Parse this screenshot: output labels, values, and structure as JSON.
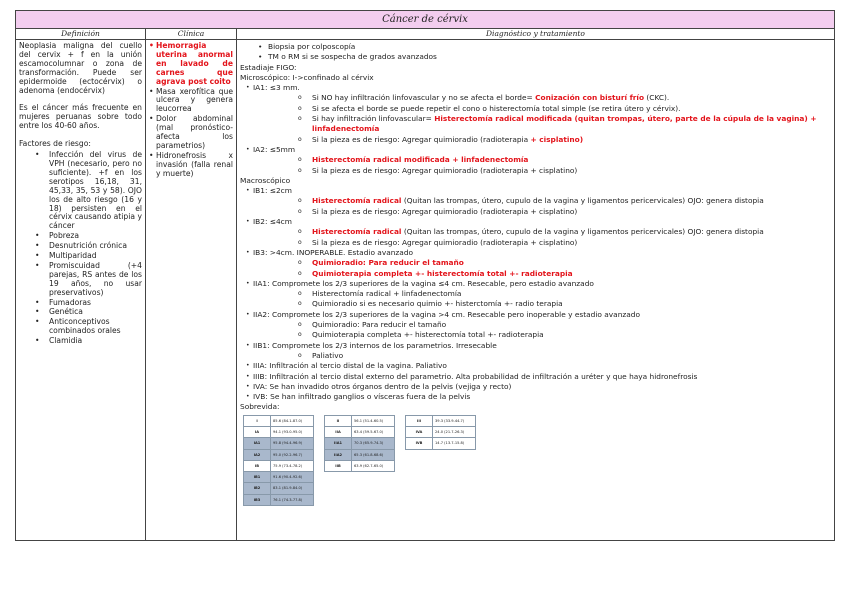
{
  "title": "Cáncer de cérvix",
  "headers": {
    "definicion": "Definición",
    "clinica": "Clínica",
    "diagnostico": "Diagnóstico y tratamiento"
  },
  "definicion": {
    "p1": "Neoplasia maligna del cuello del cervix + f en la unión escamocolumnar o zona de transformación. Puede ser epidermoide (ectocérvix) o adenoma (endocérvix)",
    "p2": "Es el cáncer más frecuente en mujeres peruanas sobre todo entre los 40-60 años.",
    "factores_label": "Factores de riesgo:",
    "factores": [
      "Infección del virus de VPH (necesario, pero no suficiente). +f en los serotipos 16,18, 31, 45,33, 35, 53 y 58). OJO los de alto riesgo (16 y 18) persisten en el cérvix causando atipia y cáncer",
      "Pobreza",
      "Desnutrición crónica",
      "Multiparidad",
      "Promiscuidad (+4 parejas, RS antes de los 19 años, no usar preservativos)",
      "Fumadoras",
      "Genética",
      "Anticonceptivos combinados orales",
      "Clamidia"
    ]
  },
  "clinica": [
    {
      "t": "Hemorragia uterina anormal en lavado de carnes que agrava post coito",
      "red": true
    },
    {
      "t": "Masa xerofítica que ulcera y genera leucorrea",
      "red": false
    },
    {
      "t": "Dolor abdominal (mal pronóstico- afecta los parametrios)",
      "red": false
    },
    {
      "t": "Hidronefrosis x invasión (falla renal y muerte)",
      "red": false
    }
  ],
  "diagnostico": [
    {
      "l": "lb",
      "s": [
        {
          "t": "Biopsia por colposcopía"
        }
      ]
    },
    {
      "l": "lb",
      "s": [
        {
          "t": "TM o RM si se sospecha de grados avanzados"
        }
      ]
    },
    {
      "l": "l0",
      "s": [
        {
          "t": "Estadiaje FIGO:"
        }
      ]
    },
    {
      "l": "l0",
      "s": [
        {
          "t": "Microscópico: I->confinado al cérvix"
        }
      ]
    },
    {
      "l": "l1",
      "s": [
        {
          "t": "IA1: ≤3 mm."
        }
      ]
    },
    {
      "l": "l2",
      "s": [
        {
          "t": "Si NO hay infiltración linfovascular y no se afecta el borde= "
        },
        {
          "t": "Conización con bisturí frío",
          "r": 1
        },
        {
          "t": " (CKC)."
        }
      ]
    },
    {
      "l": "l2",
      "s": [
        {
          "t": "Si se afecta el borde se puede repetir el cono o histerectomía total simple (se retira útero y cérvix)."
        }
      ]
    },
    {
      "l": "l2",
      "s": [
        {
          "t": "Si hay infiltración linfovascular= "
        },
        {
          "t": "Histerectomía radical modificada (quitan trompas, útero, parte de la cúpula de la vagina) + linfadenectomía",
          "r": 1
        }
      ]
    },
    {
      "l": "l2",
      "s": [
        {
          "t": "Si la pieza es de riesgo: Agregar quimioradio (radioterapia "
        },
        {
          "t": "+ cisplatino)",
          "r": 1
        }
      ]
    },
    {
      "l": "l1",
      "s": [
        {
          "t": "IA2: ≤5mm"
        }
      ]
    },
    {
      "l": "l2",
      "s": [
        {
          "t": "Histerectomía radical modificada + linfadenectomía",
          "r": 1
        }
      ]
    },
    {
      "l": "l2",
      "s": [
        {
          "t": "Si la pieza es de riesgo: Agregar quimioradio (radioterapia + cisplatino)"
        }
      ]
    },
    {
      "l": "l0",
      "s": [
        {
          "t": "Macroscópico"
        }
      ]
    },
    {
      "l": "l1",
      "s": [
        {
          "t": "IB1: ≤2cm"
        }
      ]
    },
    {
      "l": "l2",
      "s": [
        {
          "t": "Histerectomía radical",
          "r": 1
        },
        {
          "t": " (Quitan las trompas, útero, cupulo de la vagina y ligamentos pericervicales) OJO: genera distopia"
        }
      ]
    },
    {
      "l": "l2",
      "s": [
        {
          "t": "Si la pieza es de riesgo: Agregar quimioradio (radioterapia + cisplatino)"
        }
      ]
    },
    {
      "l": "l1",
      "s": [
        {
          "t": "IB2: ≤4cm"
        }
      ]
    },
    {
      "l": "l2",
      "s": [
        {
          "t": "Histerectomía radical",
          "r": 1
        },
        {
          "t": " (Quitan las trompas, útero, cupulo de la vagina y ligamentos pericervicales) OJO: genera distopia"
        }
      ]
    },
    {
      "l": "l2",
      "s": [
        {
          "t": "Si la pieza es de riesgo: Agregar quimioradio (radioterapia + cisplatino)"
        }
      ]
    },
    {
      "l": "l1",
      "s": [
        {
          "t": "IB3: >4cm. INOPERABLE. Estadio avanzado"
        }
      ]
    },
    {
      "l": "l2",
      "s": [
        {
          "t": "Quimioradio: Para reducir el tamaño",
          "r": 1
        }
      ]
    },
    {
      "l": "l2",
      "s": [
        {
          "t": "Quimioterapia completa +- histerectomía total +- radioterapia",
          "r": 1
        }
      ]
    },
    {
      "l": "l1",
      "s": [
        {
          "t": "IIA1: Compromete los 2/3 superiores de la vagina ≤4 cm. Resecable, pero estadio avanzado"
        }
      ]
    },
    {
      "l": "l2",
      "s": [
        {
          "t": "Histerectomía radical + linfadenectomía"
        }
      ]
    },
    {
      "l": "l2",
      "s": [
        {
          "t": "Quimioradio si es necesario quimio +- histerctomía +- radio terapia"
        }
      ]
    },
    {
      "l": "l1",
      "s": [
        {
          "t": "IIA2: Compromete los 2/3 superiores de la vagina >4 cm. Resecable pero inoperable y estadio avanzado"
        }
      ]
    },
    {
      "l": "l2",
      "s": [
        {
          "t": "Quimioradio: Para reducir el tamaño"
        }
      ]
    },
    {
      "l": "l2",
      "s": [
        {
          "t": "Quimioterapia completa +- histerectomía total +- radioterapia"
        }
      ]
    },
    {
      "l": "l1",
      "s": [
        {
          "t": "IIB1: Compromete los 2/3 internos de los parametrios. Irresecable"
        }
      ]
    },
    {
      "l": "l2",
      "s": [
        {
          "t": "Paliativo"
        }
      ]
    },
    {
      "l": "l1",
      "s": [
        {
          "t": "IIIA: Infiltración al tercio distal de la vagina. Paliativo"
        }
      ]
    },
    {
      "l": "l1",
      "s": [
        {
          "t": "IIIB: Infiltración al tercio distal externo del parametrio. Alta probabilidad de infiltración a uréter y que haya hidronefrosis"
        }
      ]
    },
    {
      "l": "l1",
      "s": [
        {
          "t": "IVA: Se han invadido otros órganos dentro de la pelvis (vejiga y recto)"
        }
      ]
    },
    {
      "l": "l1",
      "s": [
        {
          "t": "IVB: Se han infiltrado ganglios o vísceras fuera de la pelvis"
        }
      ]
    },
    {
      "l": "l0",
      "s": [
        {
          "t": "Sobrevida:"
        }
      ]
    }
  ],
  "sobrevida": [
    [
      {
        "k": "I",
        "v": "85.6 (84.1-87.0)"
      },
      {
        "k": "IA",
        "v": "94.1 (93.0-95.0)"
      },
      {
        "k": "IA1",
        "v": "95.8 (94.4-96.9)",
        "sh": 1
      },
      {
        "k": "IA2",
        "v": "95.0 (92.2-96.7)",
        "sh": 1
      },
      {
        "k": "IB",
        "v": "75.9 (73.4-78.2)"
      },
      {
        "k": "IB1",
        "v": "91.6 (90.4-92.6)",
        "sh": 1
      },
      {
        "k": "IB2",
        "v": "83.1 (81.9-84.0)",
        "sh": 1
      },
      {
        "k": "IB3",
        "v": "76.1 (74.3-77.8)",
        "sh": 1
      }
    ],
    [
      {
        "k": "II",
        "v": "56.1 (51.4-60.5)"
      },
      {
        "k": "IIA",
        "v": "63.4 (59.5-67.0)"
      },
      {
        "k": "IIA1",
        "v": "70.3 (65.9-74.3)",
        "sh": 1
      },
      {
        "k": "IIA2",
        "v": "65.3 (61.8-68.6)",
        "sh": 1
      },
      {
        "k": "IIB",
        "v": "63.9 (62.7-65.0)"
      }
    ],
    [
      {
        "k": "III",
        "v": "39.3 (33.9-44.7)"
      },
      {
        "k": "IVA",
        "v": "24.0 (21.7-26.3)"
      },
      {
        "k": "IVB",
        "v": "14.7 (13.7-15.8)"
      }
    ]
  ]
}
